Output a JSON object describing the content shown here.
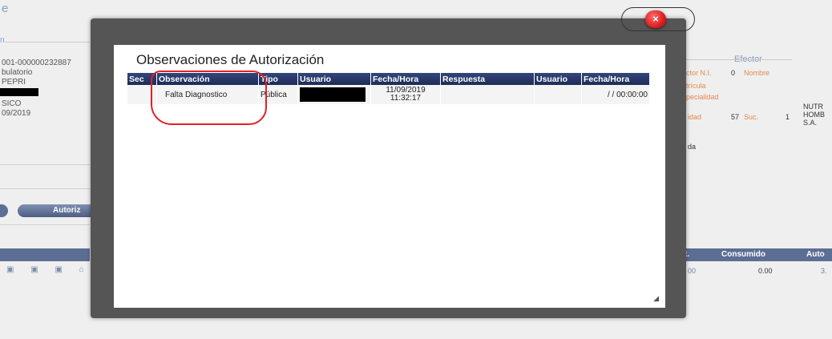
{
  "background": {
    "title_fragment": "e",
    "left_panel": {
      "legend": "n",
      "lines": [
        "001-000000232887",
        "bulatorio",
        "PEPRI",
        "SICO",
        "09/2019"
      ]
    },
    "autoriz_button": "Autoriz",
    "tool_icons": [
      "▣",
      "▣",
      "▣",
      "⌂"
    ],
    "right_panel": {
      "legend": "Efector",
      "labels": [
        "ctor N.I.",
        "Nombre",
        "trícula",
        "pecialidad",
        "idad",
        "Suc."
      ],
      "values": [
        "0",
        "57",
        "1",
        "NUTR",
        "HOMB",
        "S.A.",
        "da"
      ],
      "table_headers": [
        "t.",
        "Consumido",
        "Auto"
      ],
      "row": [
        "00",
        "0.00",
        "3."
      ]
    }
  },
  "modal": {
    "title": "Observaciones de Autorización",
    "close_label": "×",
    "resize_grip": "◢",
    "table": {
      "headers": [
        "Sec",
        "Observación",
        "Tipo",
        "Usuario",
        "Fecha/Hora",
        "Respuesta",
        "Usuario",
        "Fecha/Hora"
      ],
      "rows": [
        {
          "sec": "",
          "observacion": "Falta Diagnostico",
          "tipo": "Pública",
          "usuario": "",
          "fecha_hora_line1": "11/09/2019",
          "fecha_hora_line2": "11:32:17",
          "respuesta": "",
          "usuario_resp": "",
          "fecha_hora_resp": "/ / 00:00:00"
        }
      ]
    }
  },
  "colors": {
    "header_bg": "#1d2c57",
    "modal_frame": "#555555",
    "close_red": "#d61414",
    "annotation_red": "#e2202a",
    "label_orange": "#e38a4a",
    "legend_blue": "#8a9bbf"
  }
}
